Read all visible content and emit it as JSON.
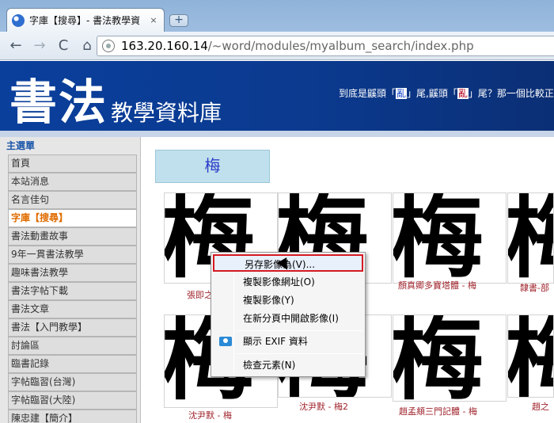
{
  "browser": {
    "tab_title": "字庫【搜尋】- 書法教學資",
    "tab_close": "×",
    "new_tab": "+",
    "back": "←",
    "forward": "→",
    "reload": "C",
    "home": "⌂",
    "url_host": "163.20.160.14",
    "url_path": "/~word/modules/myalbum_search/index.php"
  },
  "header": {
    "logo": "書法",
    "subtitle": "教學資料庫",
    "marquee_before": "到底是鼷頭「",
    "marquee_hl1": "亂",
    "marquee_mid": "」尾,鼷頭「",
    "marquee_hl2": "亂",
    "marquee_after": "」尾？那一個比較正確"
  },
  "sidebar": {
    "title": "主選單",
    "items": [
      "首頁",
      "本站消息",
      "名言佳句",
      "字庫【搜尋】",
      "書法動畫故事",
      "9年一貫書法教學",
      "趣味書法教學",
      "書法字帖下載",
      "書法文章",
      "書法【入門教學】",
      "討論區",
      "臨書記錄",
      "字帖臨習(台灣)",
      "字帖臨習(大陸)",
      "陳忠建【簡介】"
    ]
  },
  "search": {
    "term": "梅"
  },
  "thumbs": {
    "char": "梅",
    "captions": [
      "張即之",
      "",
      "顏真卿多寶塔體 - 梅",
      "隸書-部",
      "沈尹默 - 梅",
      "沈尹默 - 梅2",
      "趙孟頫三門記體 - 梅",
      "趙之"
    ]
  },
  "context_menu": {
    "items": [
      "另存影像為(V)...",
      "複製影像網址(O)",
      "複製影像(Y)",
      "在新分頁中開啟影像(I)",
      "顯示 EXIF 資料",
      "檢查元素(N)"
    ]
  }
}
